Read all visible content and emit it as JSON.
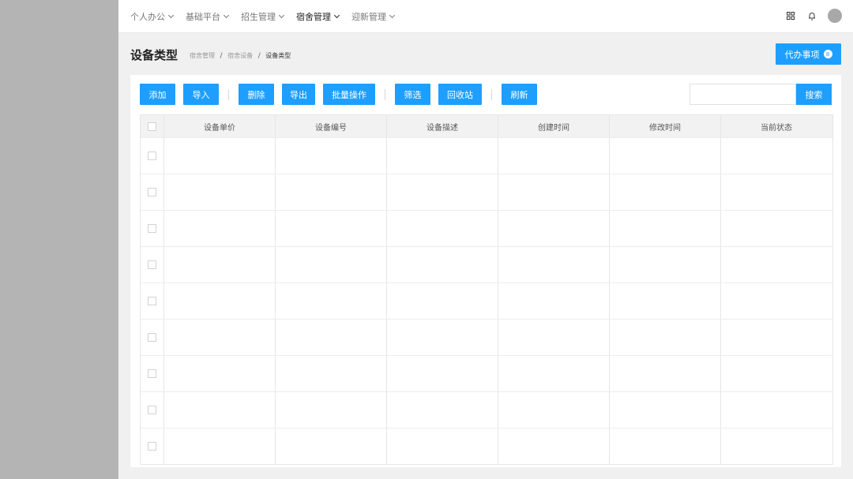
{
  "topnav": {
    "items": [
      {
        "label": "个人办公",
        "active": false
      },
      {
        "label": "基础平台",
        "active": false
      },
      {
        "label": "招生管理",
        "active": false
      },
      {
        "label": "宿舍管理",
        "active": true
      },
      {
        "label": "迎新管理",
        "active": false
      }
    ]
  },
  "header_icons": [
    "grid-icon",
    "bell-icon",
    "avatar"
  ],
  "page": {
    "title": "设备类型",
    "breadcrumb": [
      "宿舍管理",
      "宿舍设备",
      "设备类型"
    ],
    "todo_label": "代办事项",
    "todo_count": "8"
  },
  "toolbar": {
    "add": "添加",
    "import": "导入",
    "delete": "删除",
    "export": "导出",
    "batch": "批量操作",
    "filter": "筛选",
    "recycle": "回收站",
    "refresh": "刷新",
    "search_label": "搜索",
    "search_value": ""
  },
  "table": {
    "columns": [
      "设备单价",
      "设备编号",
      "设备描述",
      "创建时间",
      "修改时间",
      "当前状态"
    ],
    "row_count": 9
  },
  "colors": {
    "accent": "#1e9fff",
    "background": "#f0f0f0",
    "sidebar": "#b4b4b4"
  }
}
